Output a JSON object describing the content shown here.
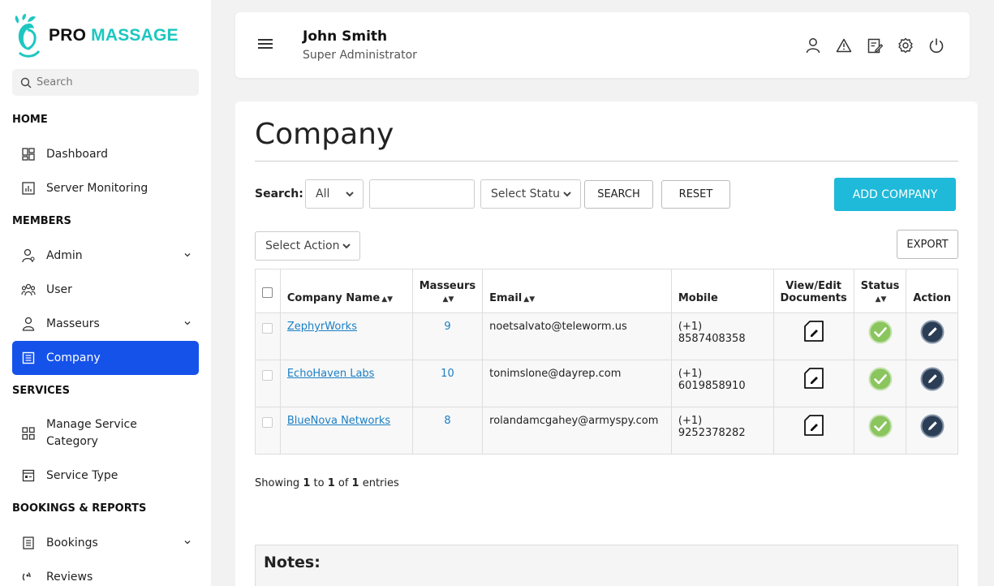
{
  "brand": {
    "part1": "PRO",
    "part2": "MASSAGE",
    "accent": "#1cc7c0"
  },
  "sidebar": {
    "search_placeholder": "Search",
    "sections": {
      "home": "HOME",
      "members": "MEMBERS",
      "services": "SERVICES",
      "bookings": "BOOKINGS & REPORTS"
    },
    "items": {
      "dashboard": "Dashboard",
      "server_monitoring": "Server Monitoring",
      "admin": "Admin",
      "user": "User",
      "masseurs": "Masseurs",
      "company": "Company",
      "manage_service_category_1": "Manage Service",
      "manage_service_category_2": "Category",
      "service_type": "Service Type",
      "bookings": "Bookings",
      "reviews": "Reviews"
    },
    "active_color": "#1552ea"
  },
  "header": {
    "user_name": "John Smith",
    "user_role": "Super Administrator",
    "icons": [
      "user-icon",
      "warning-icon",
      "edit-note-icon",
      "settings-icon",
      "power-icon"
    ]
  },
  "page": {
    "title": "Company",
    "search_label": "Search:",
    "filter_select": "All",
    "search_input_value": "",
    "status_select": "Select Status",
    "search_button": "SEARCH",
    "reset_button": "RESET",
    "add_button": "ADD COMPANY",
    "action_select": "Select Action",
    "export_button": "EXPORT",
    "primary_color": "#1fb9d9"
  },
  "table": {
    "columns": {
      "company_name": "Company Name",
      "masseurs": "Masseurs",
      "email": "Email",
      "mobile": "Mobile",
      "documents_1": "View/Edit",
      "documents_2": "Documents",
      "status": "Status",
      "action": "Action"
    },
    "rows": [
      {
        "name": "ZephyrWorks",
        "masseurs": "9",
        "email": "noetsalvato@teleworm.us",
        "mobile": "(+1) 8587408358"
      },
      {
        "name": "EchoHaven Labs",
        "masseurs": "10",
        "email": "tonimslone@dayrep.com",
        "mobile": "(+1) 6019858910"
      },
      {
        "name": "BlueNova Networks",
        "masseurs": "8",
        "email": "rolandamcgahey@armyspy.com",
        "mobile": "(+1) 9252378282"
      }
    ]
  },
  "footer": {
    "showing_prefix": "Showing ",
    "from": "1",
    "to_word": " to ",
    "to": "1",
    "of_word": " of ",
    "total": "1",
    "suffix": " entries"
  },
  "notes": {
    "title": "Notes:"
  }
}
